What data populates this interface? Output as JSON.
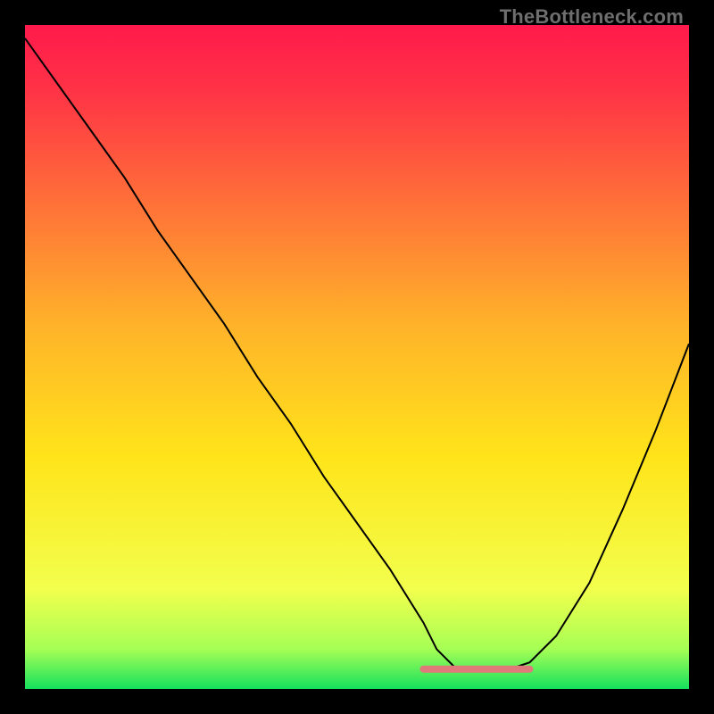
{
  "watermark": "TheBottleneck.com",
  "chart_data": {
    "type": "line",
    "title": "",
    "xlabel": "",
    "ylabel": "",
    "xlim": [
      0,
      100
    ],
    "ylim": [
      0,
      100
    ],
    "grid": false,
    "legend": false,
    "gradient_colors": {
      "top": "#ff1a4b",
      "mid": "#ffd400",
      "bottom_glow": "#f4ff66",
      "bottom": "#15e05d"
    },
    "series": [
      {
        "name": "bottleneck-curve",
        "color": "#000000",
        "stroke_width": 2,
        "x": [
          0,
          5,
          10,
          15,
          20,
          25,
          30,
          35,
          40,
          45,
          50,
          55,
          60,
          62,
          65,
          68,
          70,
          73,
          76,
          80,
          85,
          90,
          95,
          100
        ],
        "values": [
          98,
          91,
          84,
          77,
          69,
          62,
          55,
          47,
          40,
          32,
          25,
          18,
          10,
          6,
          3,
          3,
          3,
          3,
          4,
          8,
          16,
          27,
          39,
          52
        ]
      },
      {
        "name": "optimal-range-marker",
        "color": "#e07a7a",
        "stroke_width": 8,
        "x": [
          60,
          62,
          64,
          66,
          68,
          70,
          72,
          74,
          76
        ],
        "values": [
          3,
          3,
          3,
          3,
          3,
          3,
          3,
          3,
          3
        ]
      }
    ]
  }
}
